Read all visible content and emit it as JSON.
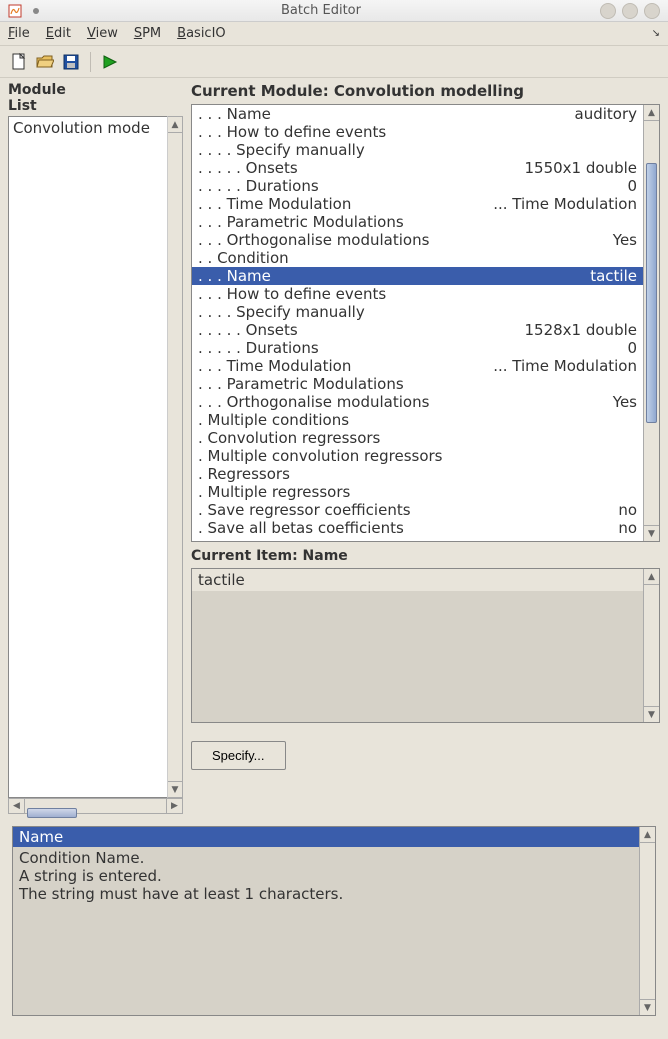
{
  "titlebar": {
    "title": "Batch Editor"
  },
  "menubar": {
    "file": "File",
    "edit": "Edit",
    "view": "View",
    "spm": "SPM",
    "basicio": "BasicIO"
  },
  "toolbar": {
    "new": "new-file",
    "open": "open-file",
    "save": "save-file",
    "run": "run"
  },
  "left": {
    "label": "Module List",
    "items": [
      "Convolution mode"
    ]
  },
  "module_header": "Current Module: Convolution modelling",
  "params": [
    {
      "label": ". . . Name",
      "value": "auditory",
      "selected": false
    },
    {
      "label": ". . . How to define events",
      "value": "",
      "selected": false
    },
    {
      "label": ". . . . Specify manually",
      "value": "",
      "selected": false
    },
    {
      "label": ". . . . . Onsets",
      "value": "1550x1 double",
      "selected": false
    },
    {
      "label": ". . . . . Durations",
      "value": "0",
      "selected": false
    },
    {
      "label": ". . . Time Modulation",
      "value": "... Time Modulation",
      "selected": false
    },
    {
      "label": ". . . Parametric Modulations",
      "value": "",
      "selected": false
    },
    {
      "label": ". . . Orthogonalise modulations",
      "value": "Yes",
      "selected": false
    },
    {
      "label": ". . Condition",
      "value": "",
      "selected": false
    },
    {
      "label": ". . . Name",
      "value": "tactile",
      "selected": true
    },
    {
      "label": ". . . How to define events",
      "value": "",
      "selected": false
    },
    {
      "label": ". . . . Specify manually",
      "value": "",
      "selected": false
    },
    {
      "label": ". . . . . Onsets",
      "value": "1528x1 double",
      "selected": false
    },
    {
      "label": ". . . . . Durations",
      "value": "0",
      "selected": false
    },
    {
      "label": ". . . Time Modulation",
      "value": "... Time Modulation",
      "selected": false
    },
    {
      "label": ". . . Parametric Modulations",
      "value": "",
      "selected": false
    },
    {
      "label": ". . . Orthogonalise modulations",
      "value": "Yes",
      "selected": false
    },
    {
      "label": ". Multiple conditions",
      "value": "",
      "selected": false
    },
    {
      "label": ". Convolution regressors",
      "value": "",
      "selected": false
    },
    {
      "label": ". Multiple convolution regressors",
      "value": "",
      "selected": false
    },
    {
      "label": ". Regressors",
      "value": "",
      "selected": false
    },
    {
      "label": ". Multiple regressors",
      "value": "",
      "selected": false
    },
    {
      "label": ". Save regressor coefficients",
      "value": "no",
      "selected": false
    },
    {
      "label": ". Save all betas coefficients",
      "value": "no",
      "selected": false
    }
  ],
  "current_item": {
    "label": "Current Item: Name",
    "rows": [
      "tactile"
    ]
  },
  "specify": {
    "label": "Specify..."
  },
  "help": {
    "title": "Name",
    "body": "Condition Name.\nA string is entered.\nThe string must have at least 1 characters."
  }
}
